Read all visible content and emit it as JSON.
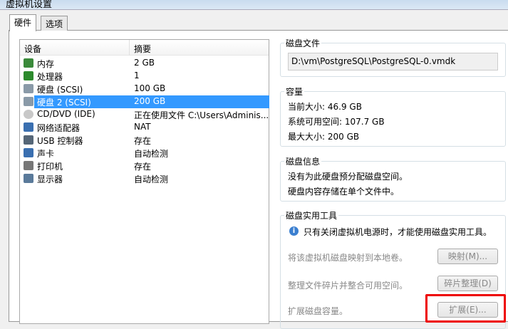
{
  "window": {
    "title": "虚拟机设置"
  },
  "tabs": [
    {
      "label": "硬件"
    },
    {
      "label": "选项"
    }
  ],
  "devices": {
    "headers": {
      "device": "设备",
      "summary": "摘要"
    },
    "rows": [
      {
        "name": "内存",
        "summary": "2 GB",
        "icon": "memory-icon"
      },
      {
        "name": "处理器",
        "summary": "1",
        "icon": "cpu-icon"
      },
      {
        "name": "硬盘 (SCSI)",
        "summary": "100 GB",
        "icon": "hard-disk-icon"
      },
      {
        "name": "硬盘 2 (SCSI)",
        "summary": "200 GB",
        "icon": "hard-disk-icon",
        "selected": true
      },
      {
        "name": "CD/DVD (IDE)",
        "summary": "正在使用文件 C:\\Users\\Adminis...",
        "icon": "cd-icon"
      },
      {
        "name": "网络适配器",
        "summary": "NAT",
        "icon": "network-icon"
      },
      {
        "name": "USB 控制器",
        "summary": "存在",
        "icon": "usb-icon"
      },
      {
        "name": "声卡",
        "summary": "自动检测",
        "icon": "sound-icon"
      },
      {
        "name": "打印机",
        "summary": "存在",
        "icon": "printer-icon"
      },
      {
        "name": "显示器",
        "summary": "自动检测",
        "icon": "display-icon"
      }
    ]
  },
  "disk_file": {
    "title": "磁盘文件",
    "path": "D:\\vm\\PostgreSQL\\PostgreSQL-0.vmdk"
  },
  "capacity": {
    "title": "容量",
    "current": "当前大小: 46.9 GB",
    "available": "系统可用空间: 107.7 GB",
    "max": "最大大小: 200 GB"
  },
  "disk_info": {
    "title": "磁盘信息",
    "line1": "没有为此硬盘预分配磁盘空间。",
    "line2": "硬盘内容存储在单个文件中。"
  },
  "utilities": {
    "title": "磁盘实用工具",
    "notice": "只有关闭虚拟机电源时，才能使用磁盘实用工具。",
    "map_label": "将该虚拟机磁盘映射到本地卷。",
    "map_button": "映射(M)...",
    "defrag_label": "整理文件碎片并整合可用空间。",
    "defrag_button": "碎片整理(D)",
    "expand_label": "扩展磁盘容量。",
    "expand_button": "扩展(E)..."
  }
}
